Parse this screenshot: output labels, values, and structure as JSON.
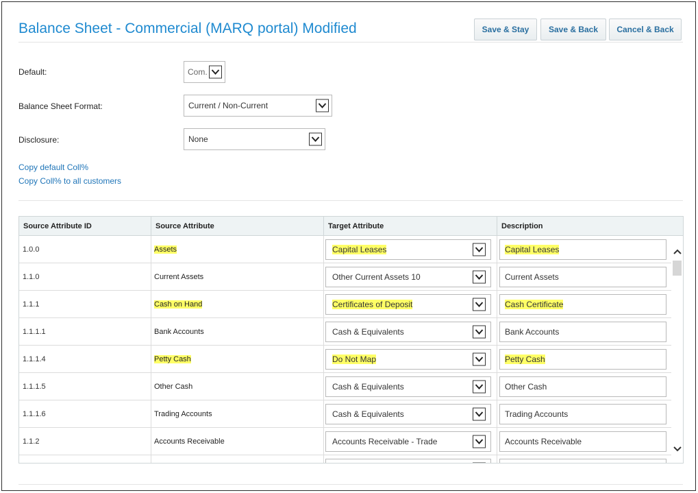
{
  "header": {
    "title": "Balance Sheet - Commercial (MARQ portal) Modified",
    "buttons": {
      "save_stay": "Save & Stay",
      "save_back": "Save & Back",
      "cancel_back": "Cancel & Back"
    }
  },
  "form": {
    "default": {
      "label": "Default:",
      "value": "Com."
    },
    "format": {
      "label": "Balance Sheet Format:",
      "value": "Current / Non-Current"
    },
    "disclosure": {
      "label": "Disclosure:",
      "value": "None"
    }
  },
  "links": {
    "copy_default": "Copy default Coll%",
    "copy_all": "Copy Coll% to all customers"
  },
  "table": {
    "columns": [
      "Source Attribute ID",
      "Source Attribute",
      "Target Attribute",
      "Description"
    ],
    "rows": [
      {
        "id": "1.0.0",
        "source": "Assets",
        "target": "Capital Leases",
        "description": "Capital Leases",
        "highlight": true
      },
      {
        "id": "1.1.0",
        "source": "Current Assets",
        "target": "Other Current Assets 10",
        "description": "Current Assets",
        "highlight": false
      },
      {
        "id": "1.1.1",
        "source": "Cash on Hand",
        "target": "Certificates of Deposit",
        "description": "Cash Certificate",
        "highlight": true
      },
      {
        "id": "1.1.1.1",
        "source": "Bank Accounts",
        "target": "Cash & Equivalents",
        "description": "Bank Accounts",
        "highlight": false
      },
      {
        "id": "1.1.1.4",
        "source": "Petty Cash",
        "target": "Do Not Map",
        "description": "Petty Cash",
        "highlight": true
      },
      {
        "id": "1.1.1.5",
        "source": "Other Cash",
        "target": "Cash & Equivalents",
        "description": "Other Cash",
        "highlight": false
      },
      {
        "id": "1.1.1.6",
        "source": "Trading Accounts",
        "target": "Cash & Equivalents",
        "description": "Trading Accounts",
        "highlight": false
      },
      {
        "id": "1.1.2",
        "source": "Accounts Receivable",
        "target": "Accounts Receivable - Trade",
        "description": "Accounts Receivable",
        "highlight": false
      },
      {
        "id": "",
        "source": "",
        "target": "",
        "description": "",
        "highlight": false
      }
    ]
  },
  "colors": {
    "title": "#1f8ad0",
    "link": "#1f75b8",
    "highlight": "#ffff66",
    "header_bg": "#eef3f4"
  },
  "icons": {
    "dropdown": "chevron-down-icon",
    "scroll_up": "chevron-up-icon",
    "scroll_down": "chevron-down-icon"
  }
}
